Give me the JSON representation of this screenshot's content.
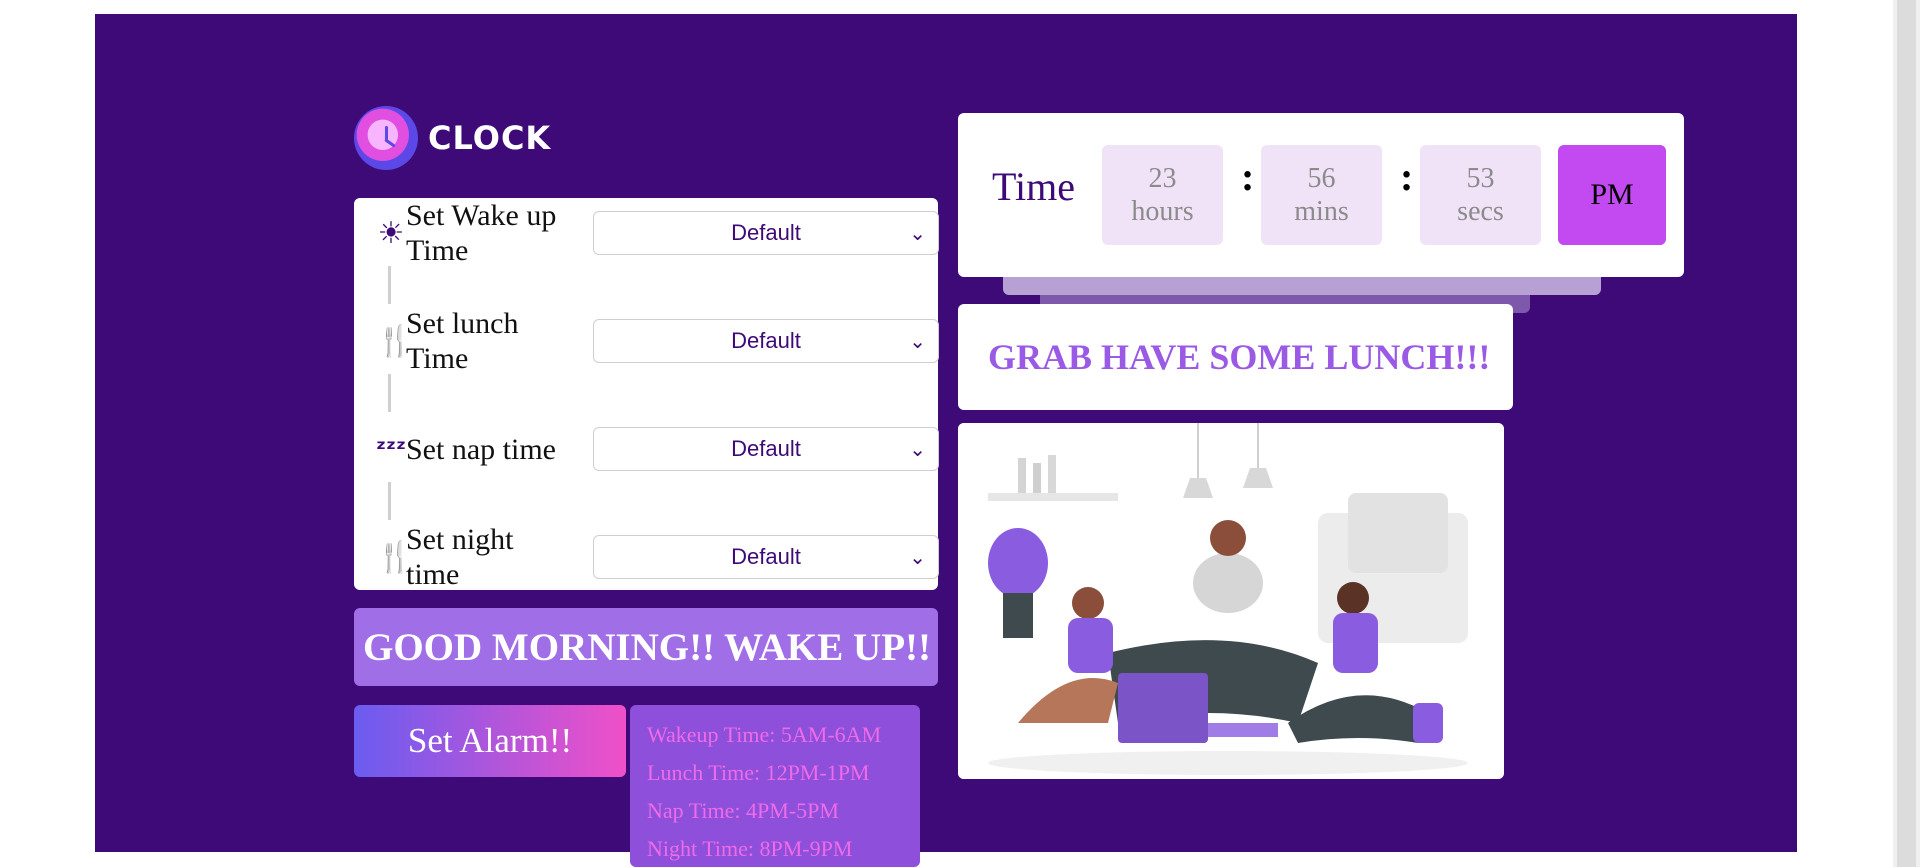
{
  "logo": {
    "text": "CLOCK"
  },
  "settings": {
    "rows": [
      {
        "icon": "sun-icon",
        "label": "Set Wake up Time",
        "value": "Default"
      },
      {
        "icon": "fork-spoon-icon",
        "label": "Set lunch Time",
        "value": "Default"
      },
      {
        "icon": "zzz-icon",
        "label": "Set nap time",
        "value": "Default"
      },
      {
        "icon": "fork-spoon-icon",
        "label": "Set night time",
        "value": "Default"
      }
    ]
  },
  "message": {
    "text": "GOOD MORNING!! WAKE UP!!"
  },
  "alarm_button": {
    "label": "Set Alarm!!"
  },
  "schedule": {
    "items": [
      "Wakeup Time: 5AM-6AM",
      "Lunch Time: 12PM-1PM",
      "Nap Time: 4PM-5PM",
      "Night Time: 8PM-9PM"
    ]
  },
  "clock": {
    "label": "Time",
    "hours": "23",
    "hours_unit": "hours",
    "mins": "56",
    "mins_unit": "mins",
    "secs": "53",
    "secs_unit": "secs",
    "ampm": "PM",
    "separator": ":"
  },
  "lunch_message": {
    "text": "GRAB HAVE SOME LUNCH!!!"
  },
  "illustration": {
    "name": "people-eating-lunch-illustration"
  },
  "colors": {
    "panel": "#3d0a78",
    "accent": "#c24af0",
    "message_bg": "#a06ee6",
    "schedule_bg": "#8e4fdb",
    "schedule_text": "#f06be8",
    "lunch_text": "#9a5ae6"
  }
}
